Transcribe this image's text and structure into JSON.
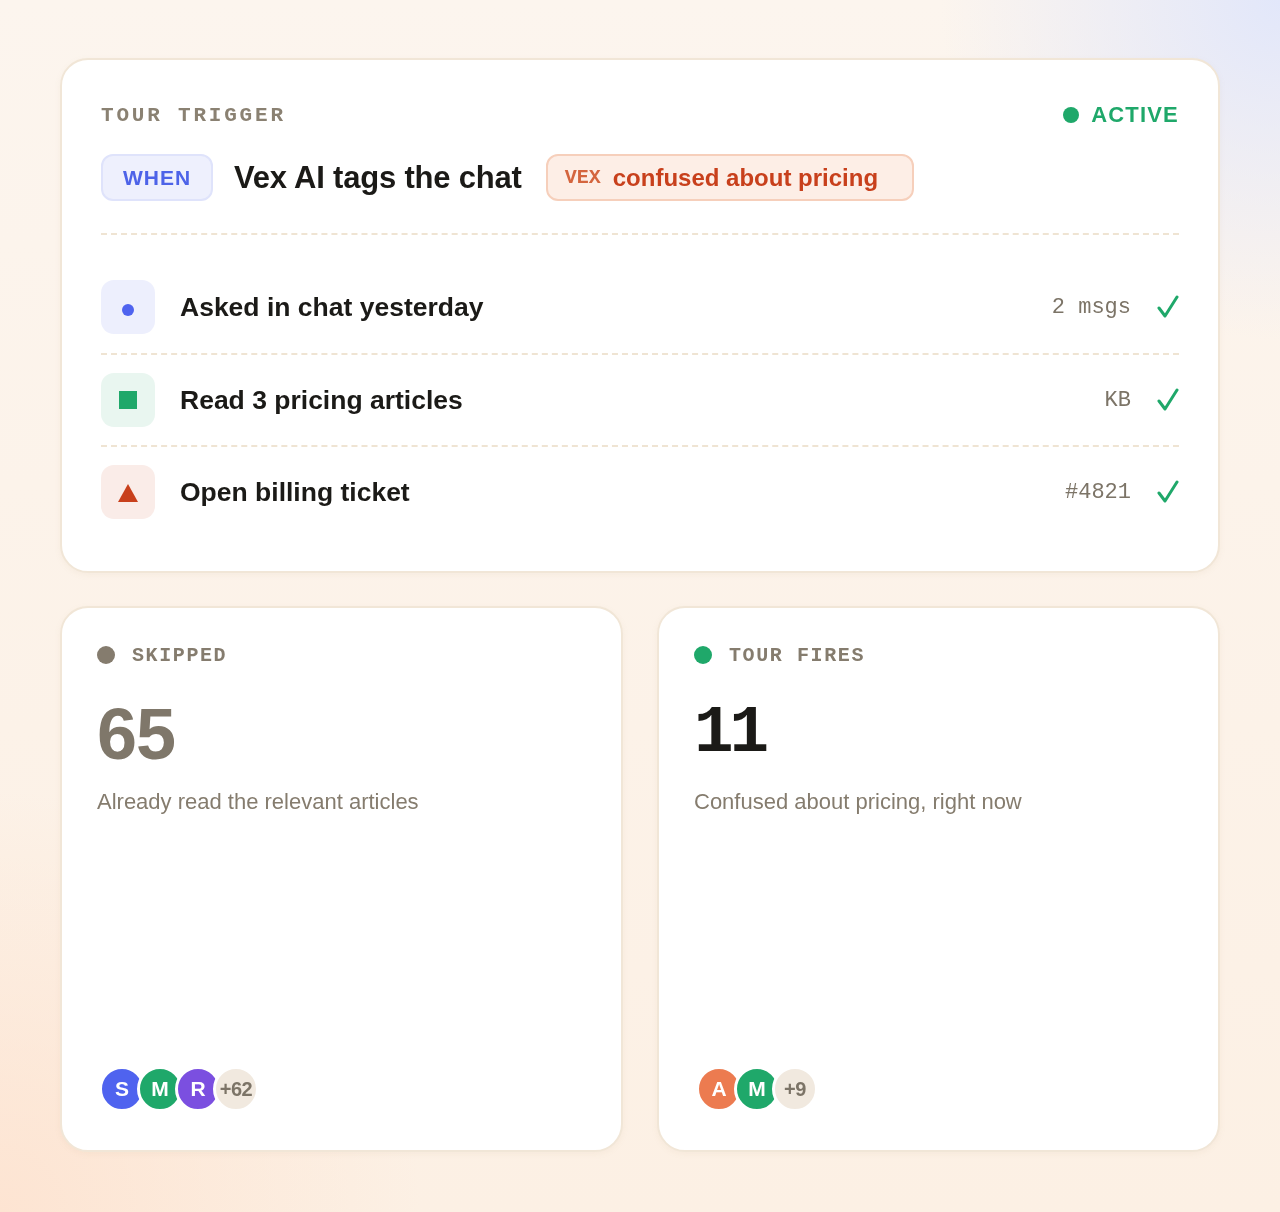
{
  "trigger": {
    "title": "TOUR TRIGGER",
    "status": {
      "label": "ACTIVE",
      "active": true
    },
    "when": "WHEN",
    "event": "Vex AI tags the chat",
    "tag": {
      "source": "VEX",
      "label": "confused about pricing"
    },
    "conditions": [
      {
        "kind": "dot",
        "color": "#4f63ef",
        "label": "Asked in chat yesterday",
        "meta": "2 msgs",
        "met": true
      },
      {
        "kind": "square",
        "color": "#1fa86a",
        "label": "Read 3 pricing articles",
        "meta": "KB",
        "met": true
      },
      {
        "kind": "triangle",
        "color": "#c8401c",
        "label": "Open billing ticket",
        "meta": "#4821",
        "met": true
      }
    ]
  },
  "outcomes": [
    {
      "kind": "muted",
      "color": "#857c6e",
      "label": "SKIPPED",
      "count": "65",
      "description": "Already read the relevant articles",
      "avatars": [
        {
          "initial": "S",
          "color": "#4f63ef"
        },
        {
          "initial": "M",
          "color": "#1fa86a"
        },
        {
          "initial": "R",
          "color": "#7b4fe0"
        }
      ],
      "more": "+62"
    },
    {
      "kind": "highlight",
      "color": "#1fa86a",
      "label": "TOUR FIRES",
      "count": "11",
      "description": "Confused about pricing, right now",
      "avatars": [
        {
          "initial": "A",
          "color": "#ec7b50"
        },
        {
          "initial": "M",
          "color": "#1fa86a"
        }
      ],
      "more": "+9"
    }
  ]
}
